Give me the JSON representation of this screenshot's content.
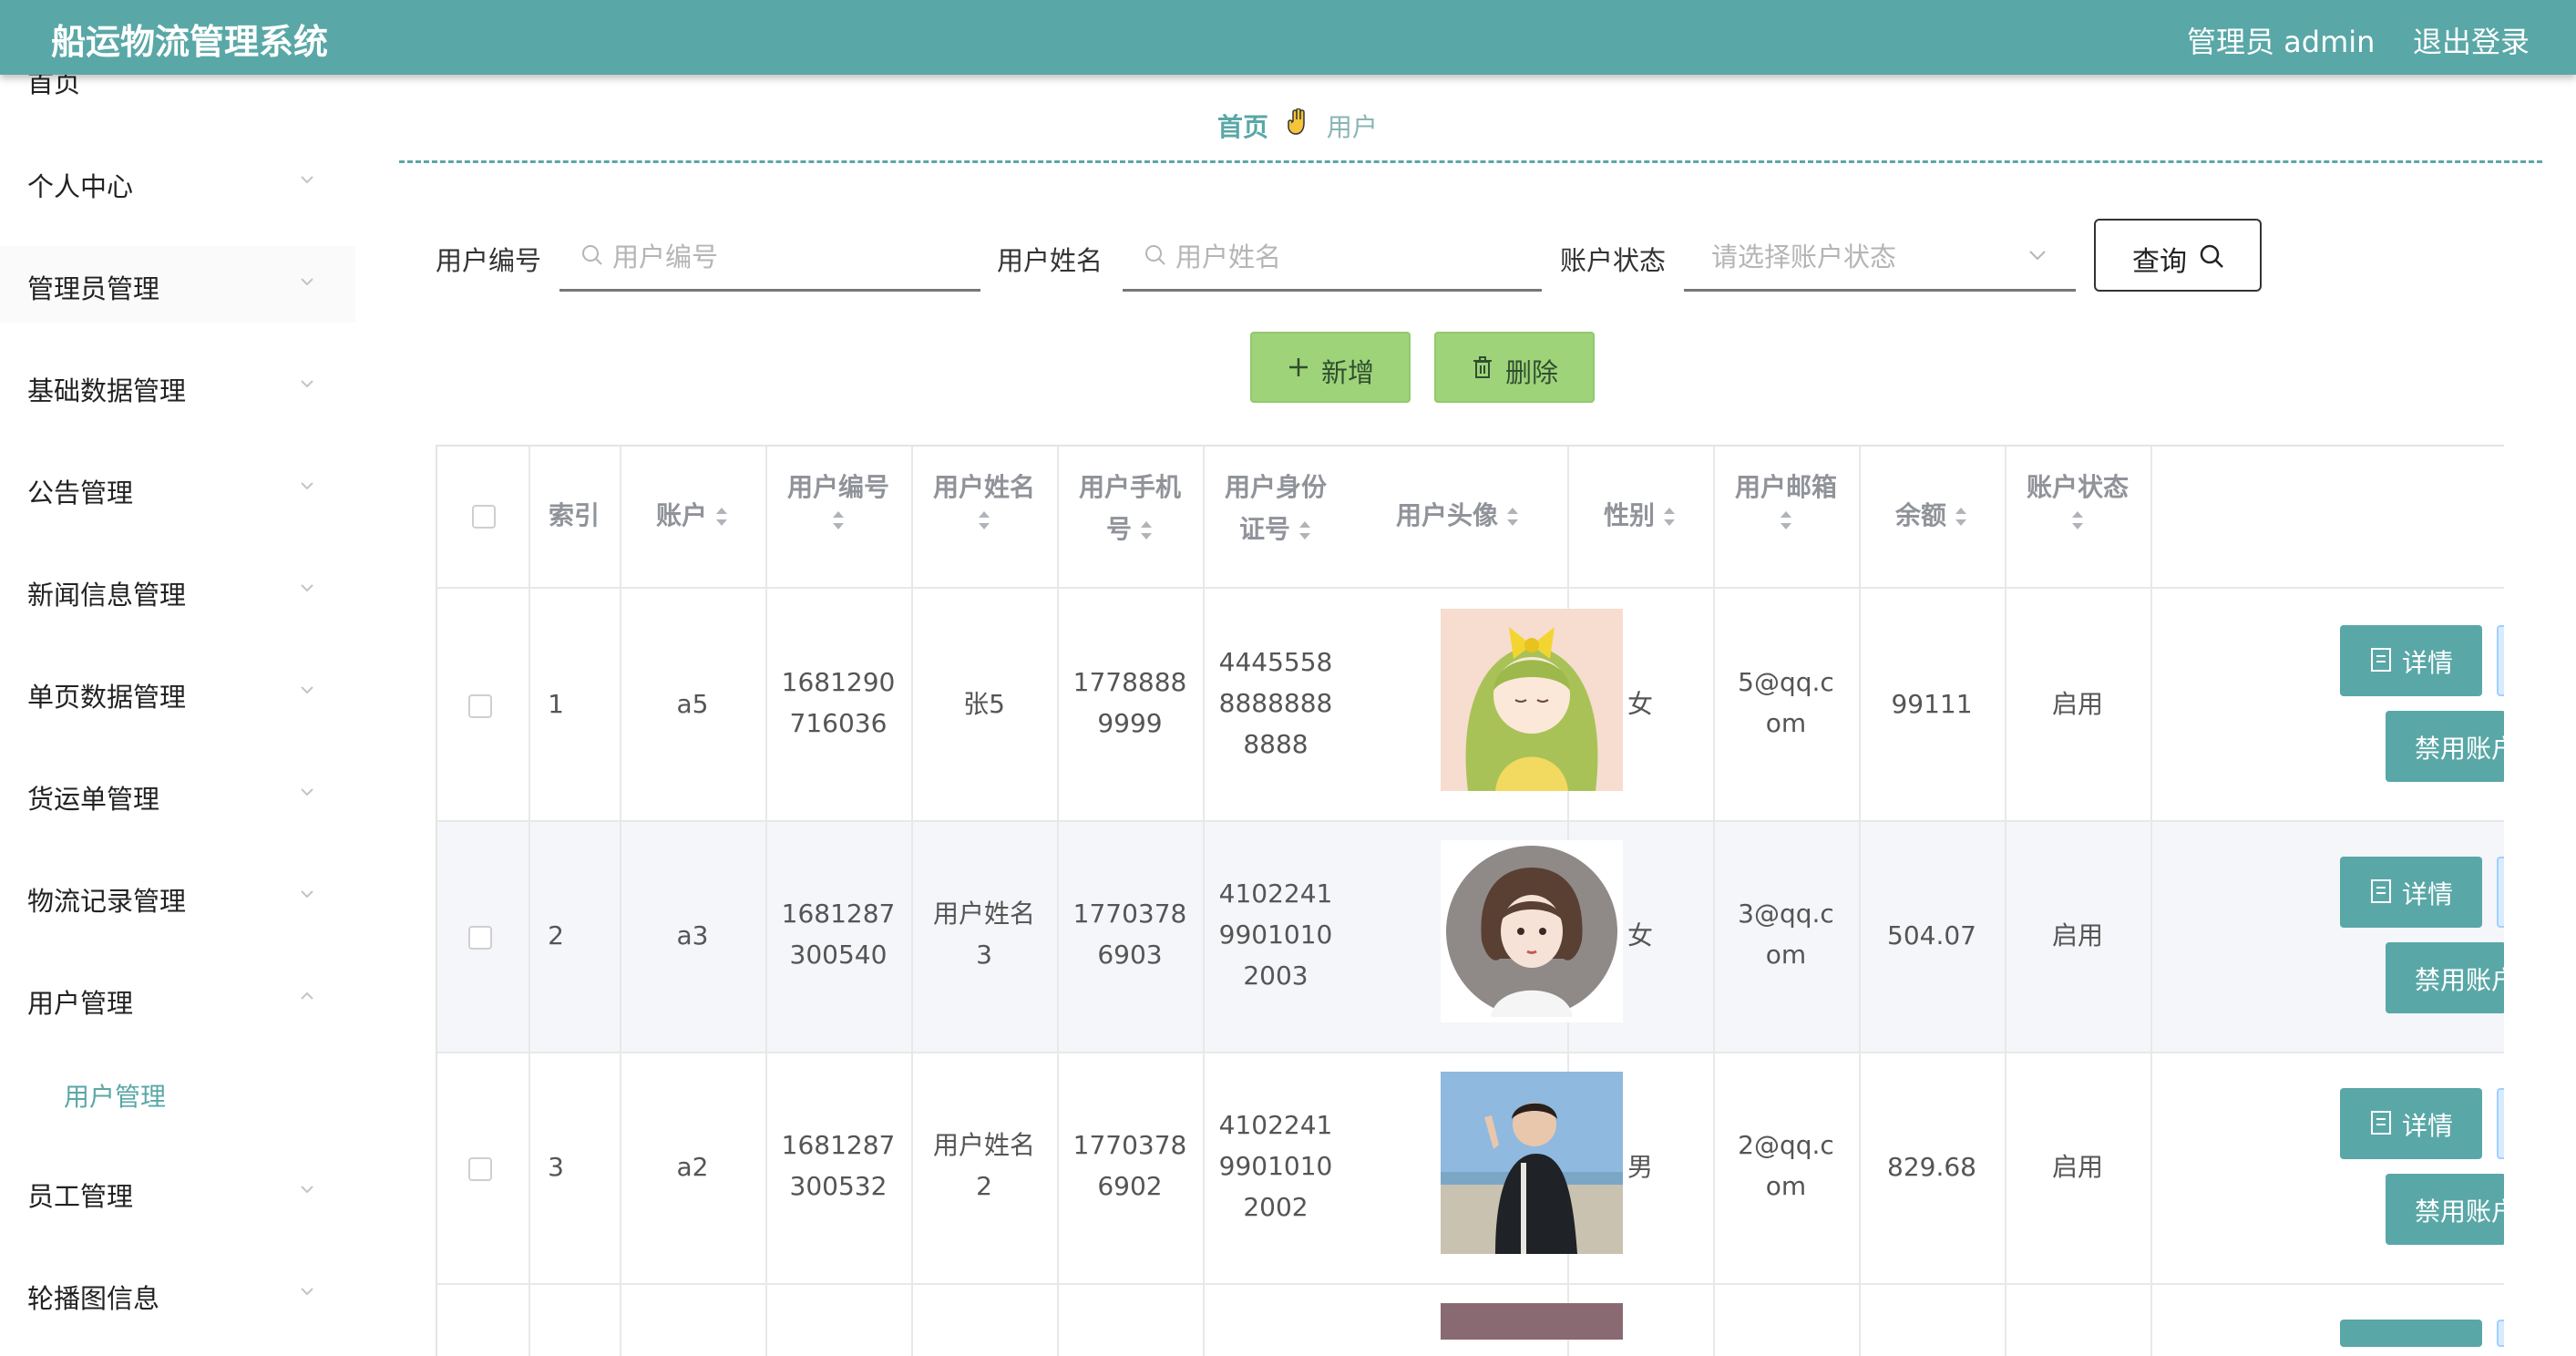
{
  "header": {
    "title": "船运物流管理系统",
    "admin_label": "管理员 admin",
    "logout_label": "退出登录",
    "bg_color": "#5aa7a7"
  },
  "sidebar": {
    "items": [
      {
        "label": "首页"
      },
      {
        "label": "个人中心"
      },
      {
        "label": "管理员管理"
      },
      {
        "label": "基础数据管理"
      },
      {
        "label": "公告管理"
      },
      {
        "label": "新闻信息管理"
      },
      {
        "label": "单页数据管理"
      },
      {
        "label": "货运单管理"
      },
      {
        "label": "物流记录管理"
      },
      {
        "label": "用户管理"
      },
      {
        "label": "员工管理"
      },
      {
        "label": "轮播图信息"
      }
    ],
    "sub_item": {
      "label": "用户管理"
    }
  },
  "breadcrumb": {
    "home": "首页",
    "current": "用户"
  },
  "search": {
    "user_no_label": "用户编号",
    "user_no_placeholder": "用户编号",
    "user_name_label": "用户姓名",
    "user_name_placeholder": "用户姓名",
    "status_label": "账户状态",
    "status_placeholder": "请选择账户状态",
    "query_label": "查询"
  },
  "actions": {
    "add_label": "新增",
    "delete_label": "删除"
  },
  "table": {
    "headers": {
      "index": "索引",
      "account": "账户",
      "user_no_1": "用户编号",
      "user_name": "用户姓名",
      "phone_1": "用户手机",
      "phone_2": "号",
      "idcard_1": "用户身份",
      "idcard_2": "证号",
      "avatar": "用户头像",
      "gender": "性别",
      "email": "用户邮箱",
      "balance": "余额",
      "status": "账户状态"
    },
    "rows": [
      {
        "index": "1",
        "account": "a5",
        "user_no": [
          "1681290",
          "716036"
        ],
        "name": [
          "张5"
        ],
        "phone": [
          "1778888",
          "9999"
        ],
        "idcard": [
          "4445558",
          "8888888",
          "8888"
        ],
        "avatar": "girl-bow-avatar",
        "gender": "女",
        "email": [
          "5@qq.c",
          "om"
        ],
        "balance": "99111",
        "status": "启用",
        "detail_label": "详情",
        "disable_label": "禁用账户"
      },
      {
        "index": "2",
        "account": "a3",
        "user_no": [
          "1681287",
          "300540"
        ],
        "name": [
          "用户姓名",
          "3"
        ],
        "phone": [
          "1770378",
          "6903"
        ],
        "idcard": [
          "4102241",
          "9901010",
          "2003"
        ],
        "avatar": "girl-bob-avatar",
        "gender": "女",
        "email": [
          "3@qq.c",
          "om"
        ],
        "balance": "504.07",
        "status": "启用",
        "detail_label": "详情",
        "disable_label": "禁用账户"
      },
      {
        "index": "3",
        "account": "a2",
        "user_no": [
          "1681287",
          "300532"
        ],
        "name": [
          "用户姓名",
          "2"
        ],
        "phone": [
          "1770378",
          "6902"
        ],
        "idcard": [
          "4102241",
          "9901010",
          "2002"
        ],
        "avatar": "boy-photo-avatar",
        "gender": "男",
        "email": [
          "2@qq.c",
          "om"
        ],
        "balance": "829.68",
        "status": "启用",
        "detail_label": "详情",
        "disable_label": "禁用账户"
      }
    ]
  }
}
